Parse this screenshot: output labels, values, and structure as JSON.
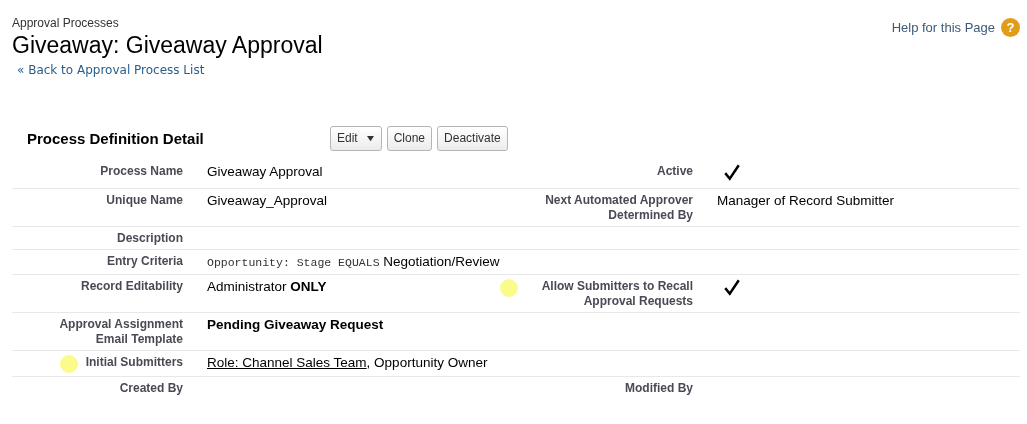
{
  "header": {
    "breadcrumb": "Approval Processes",
    "title": "Giveaway: Giveaway Approval",
    "back_link": "« Back to Approval Process List",
    "help_link": "Help for this Page",
    "help_icon": "?"
  },
  "section": {
    "title": "Process Definition Detail",
    "buttons": [
      {
        "label": "Edit",
        "dropdown": true
      },
      {
        "label": "Clone",
        "dropdown": false
      },
      {
        "label": "Deactivate",
        "dropdown": false
      }
    ]
  },
  "rows": [
    {
      "left": {
        "label": "Process Name",
        "marked": false,
        "value": [
          {
            "kind": "text",
            "text": "Giveaway Approval"
          }
        ]
      },
      "right": {
        "label": "Active",
        "marked": false,
        "kind": "checkbox",
        "checked": true
      }
    },
    {
      "left": {
        "label": "Unique Name",
        "marked": false,
        "value": [
          {
            "kind": "text",
            "text": "Giveaway_Approval"
          }
        ]
      },
      "right": {
        "label": "Next Automated Approver Determined By",
        "marked": false,
        "kind": "text",
        "value": "Manager of Record Submitter"
      }
    },
    {
      "left": {
        "label": "Description",
        "marked": false
      }
    },
    {
      "left": {
        "label": "Entry Criteria",
        "marked": false,
        "value": [
          {
            "kind": "code",
            "text": "Opportunity: Stage EQUALS"
          },
          {
            "kind": "text",
            "text": " Negotiation/Review"
          }
        ]
      }
    },
    {
      "left": {
        "label": "Record Editability",
        "marked": false,
        "value": [
          {
            "kind": "text",
            "text": "Administrator **ONLY**"
          }
        ]
      },
      "right": {
        "label": "Allow Submitters to Recall Approval Requests",
        "marked": true,
        "kind": "checkbox",
        "checked": true
      }
    },
    {
      "left": {
        "label": "Approval Assignment Email Template",
        "marked": false,
        "value": [
          {
            "kind": "bold",
            "text": "Pending Giveaway Request"
          }
        ]
      }
    },
    {
      "left": {
        "label": "Initial Submitters",
        "marked": true,
        "value": [
          {
            "kind": "link",
            "text": "Role: Channel Sales Team"
          },
          {
            "kind": "text",
            "text": ", Opportunity Owner"
          }
        ]
      }
    },
    {
      "left": {
        "label": "Created By",
        "marked": false
      },
      "right": {
        "label": "Modified By",
        "marked": false,
        "kind": "text"
      }
    }
  ]
}
